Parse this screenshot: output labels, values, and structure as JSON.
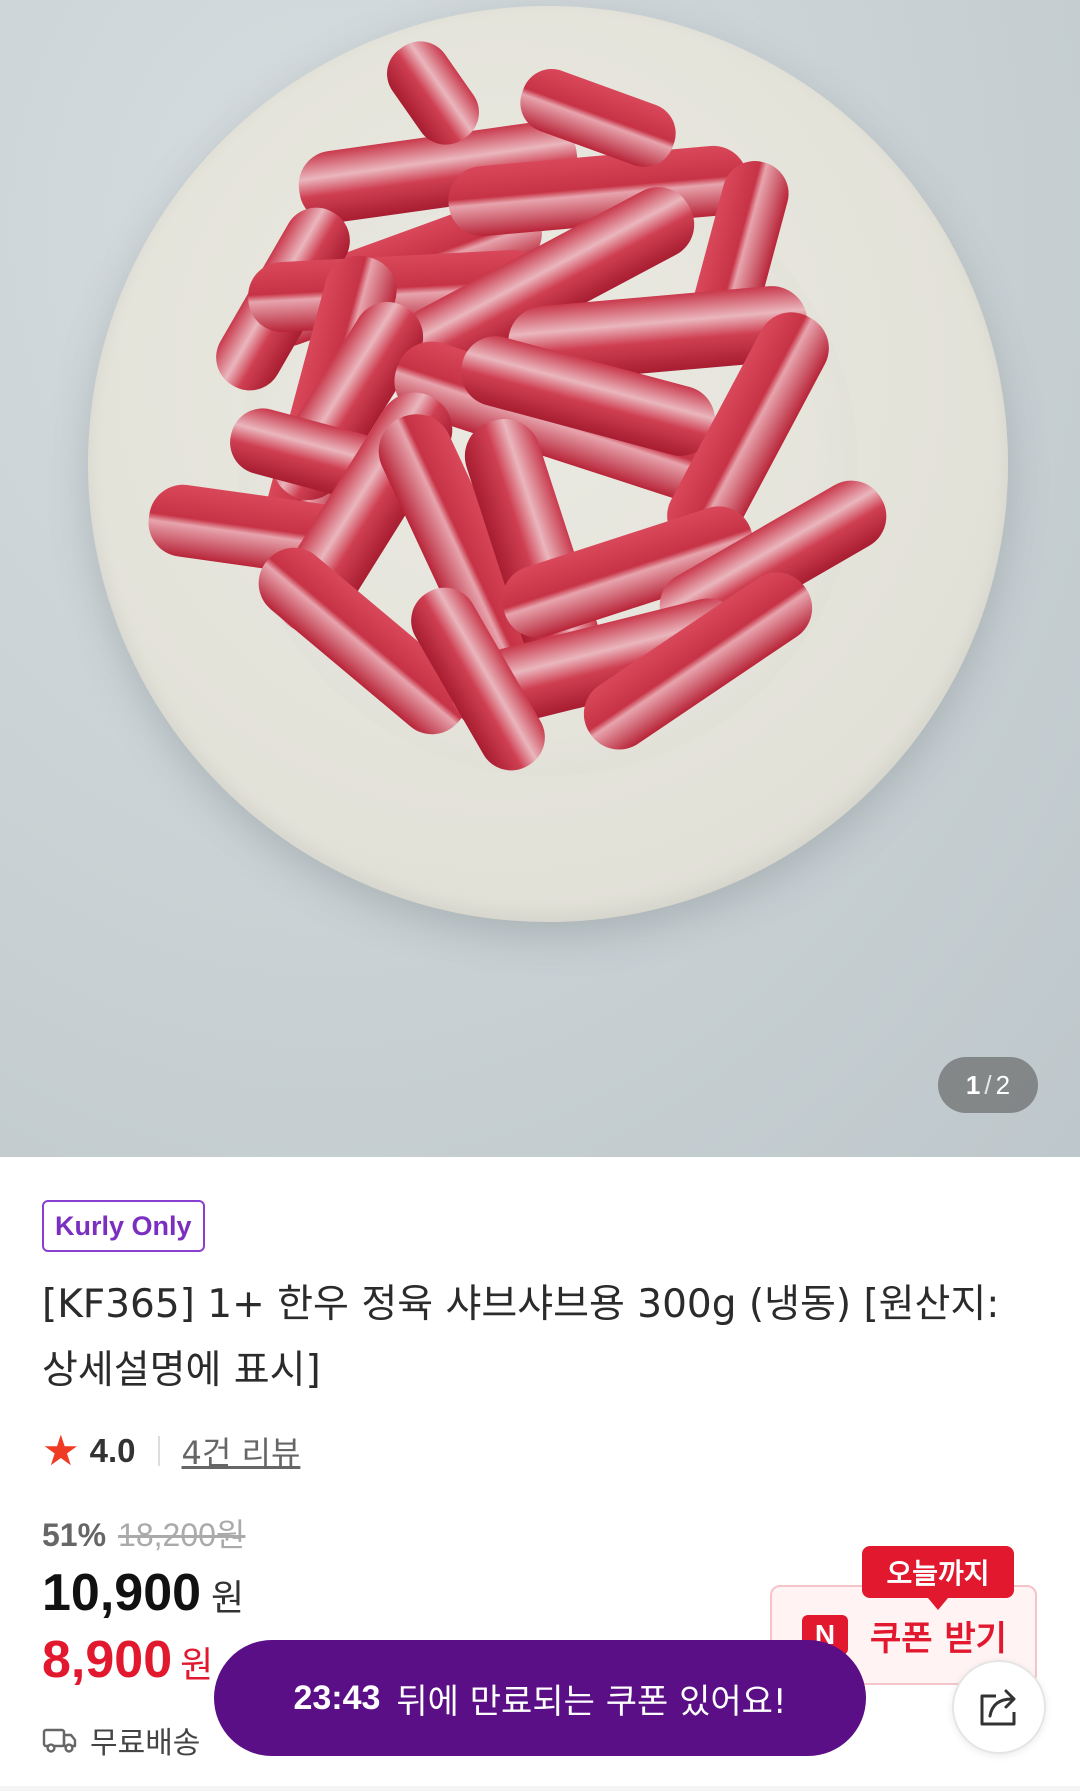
{
  "hero": {
    "image_alt": "",
    "counter_current": "1",
    "counter_separator": "/",
    "counter_total": "2"
  },
  "product": {
    "badge": "Kurly Only",
    "title_line1": "[KF365] 1+ 한우 정육 샤브샤브용 300g (냉동) [원산지:",
    "title_line2": "상세설명에 표시]",
    "rating": "4.0",
    "reviews": "4건 리뷰",
    "discount_rate": "51%",
    "original_price": "18,200원",
    "price": "10,900",
    "price_unit": "원",
    "coupon_price": "8,900",
    "coupon_price_unit": "원",
    "delivery": "무료배송"
  },
  "coupon": {
    "tag": "오늘까지",
    "icon_letter": "N",
    "label": "쿠폰 받기"
  },
  "toast": {
    "timer": "23:43",
    "message": "뒤에 만료되는 쿠폰 있어요!"
  },
  "colors": {
    "kurly_purple": "#5b0f86",
    "badge_purple": "#8b3fcf",
    "sale_red": "#e1182e",
    "star": "#f03b24"
  },
  "icons": [
    "star-icon",
    "truck-icon",
    "share-icon",
    "n-coupon-icon"
  ]
}
